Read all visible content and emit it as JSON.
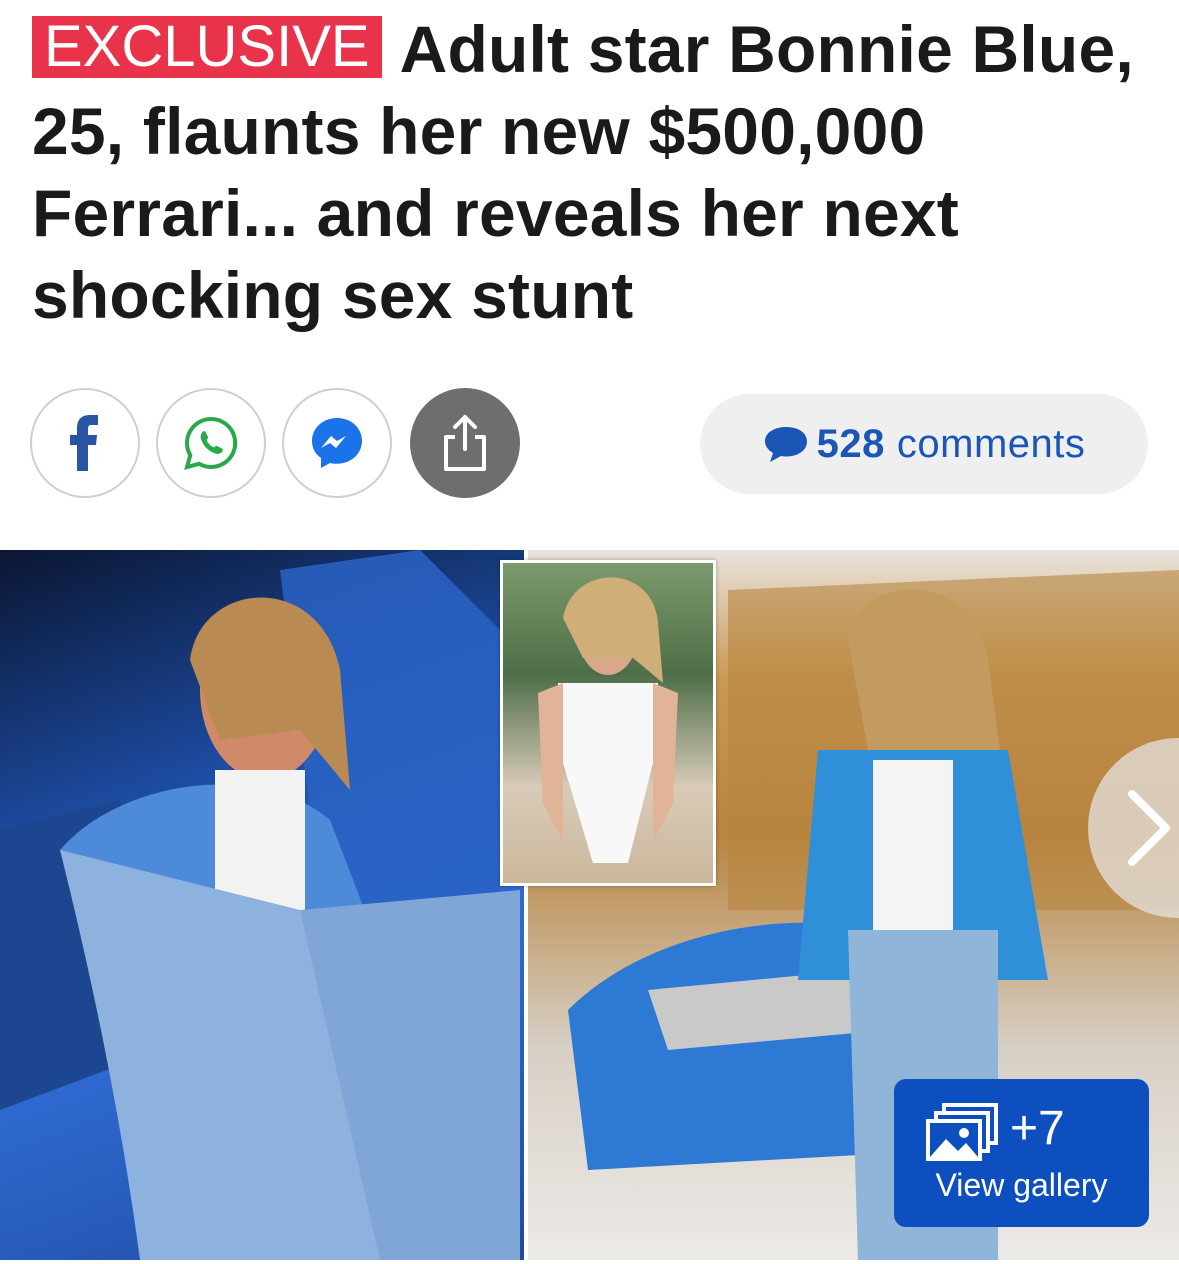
{
  "article": {
    "badge": "EXCLUSIVE",
    "headline": "Adult star Bonnie Blue, 25, flaunts her new $500,000 Ferrari... and reveals her next shocking sex stunt"
  },
  "share": {
    "buttons": [
      {
        "icon": "facebook-icon"
      },
      {
        "icon": "whatsapp-icon"
      },
      {
        "icon": "messenger-icon"
      },
      {
        "icon": "share-icon"
      }
    ],
    "comments_count": "528",
    "comments_label": "comments"
  },
  "gallery": {
    "count_label": "+7",
    "view_label": "View gallery"
  },
  "colors": {
    "badge_bg": "#e8334a",
    "link_blue": "#1b56b7",
    "gallery_bg": "#0d4fbf"
  }
}
